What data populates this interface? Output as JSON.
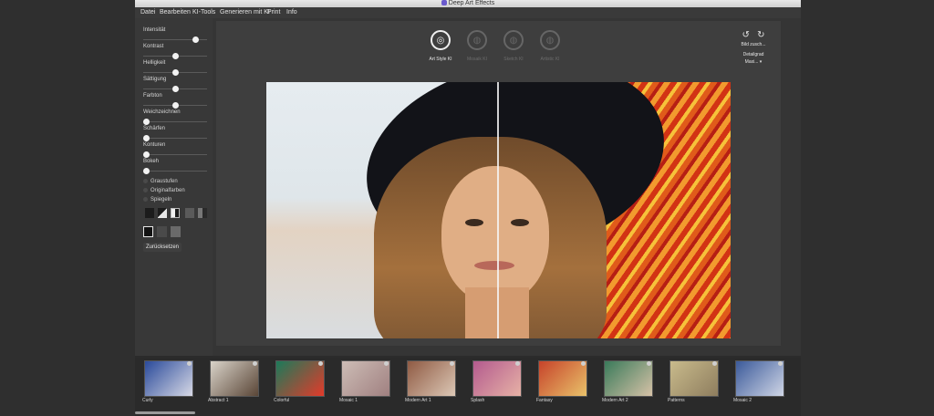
{
  "window": {
    "title": "Deep Art Effects"
  },
  "menu": [
    "Datei",
    "Bearbeiten",
    "KI-Tools",
    "Generieren mit KI",
    "Print",
    "Info"
  ],
  "adjustments": {
    "sliders": [
      {
        "label": "Intensität",
        "value": 0.85
      },
      {
        "label": "Kontrast",
        "value": 0.5
      },
      {
        "label": "Helligkeit",
        "value": 0.5
      },
      {
        "label": "Sättigung",
        "value": 0.5
      },
      {
        "label": "Farbton",
        "value": 0.5
      },
      {
        "label": "Weichzeichnen",
        "value": 0.0
      },
      {
        "label": "Schärfen",
        "value": 0.0
      },
      {
        "label": "Konturen",
        "value": 0.0
      },
      {
        "label": "Bokeh",
        "value": 0.0
      }
    ],
    "options": [
      "Graustufen",
      "Originalfarben",
      "Spiegeln"
    ],
    "reset_label": "Zurücksetzen"
  },
  "style_modes": [
    {
      "label": "Art Style KI",
      "active": true,
      "icon": "art-style-icon"
    },
    {
      "label": "Mosaik KI",
      "active": false,
      "icon": "mosaic-icon"
    },
    {
      "label": "Sketch KI",
      "active": false,
      "icon": "sketch-icon"
    },
    {
      "label": "Artistic KI",
      "active": false,
      "icon": "artistic-icon"
    }
  ],
  "right_tools": {
    "fit_label": "Bild zusch...",
    "detail_label": "Detailgrad",
    "detail_value": "Maxi..."
  },
  "filmstrip": [
    {
      "label": "Curly",
      "c1": "#2a4a9a",
      "c2": "#d7d9e6"
    },
    {
      "label": "Abstract 1",
      "c1": "#d9d3c9",
      "c2": "#5a4637"
    },
    {
      "label": "Colorful",
      "c1": "#1b7a5a",
      "c2": "#e33a2a"
    },
    {
      "label": "Mosaic 1",
      "c1": "#cdbdb6",
      "c2": "#a08080"
    },
    {
      "label": "Modern Art 1",
      "c1": "#8f5a43",
      "c2": "#dcc8b6"
    },
    {
      "label": "Splash",
      "c1": "#b35a8e",
      "c2": "#e7b2a6"
    },
    {
      "label": "Fantasy",
      "c1": "#c6432a",
      "c2": "#e9c26a"
    },
    {
      "label": "Modern Art 2",
      "c1": "#3a7a5a",
      "c2": "#d6c2a7"
    },
    {
      "label": "Patterns",
      "c1": "#c9bb8c",
      "c2": "#8e7d5e"
    },
    {
      "label": "Mosaic 2",
      "c1": "#3b5a9a",
      "c2": "#d0d6e6"
    }
  ]
}
